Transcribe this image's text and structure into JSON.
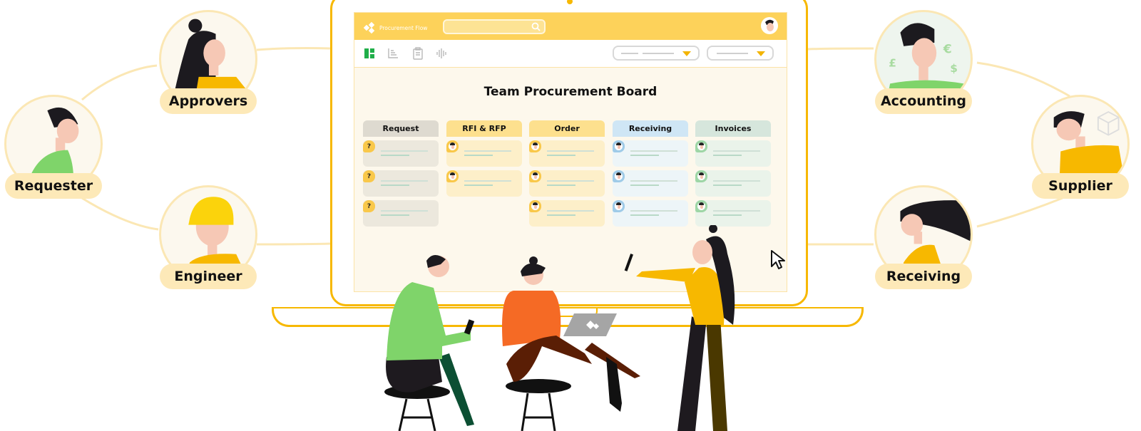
{
  "app": {
    "brand": "Procurement Flow",
    "search": {
      "placeholder": "",
      "icon": "search-icon"
    },
    "avatar": "user-avatar",
    "toolbar": {
      "icons": [
        "board-view-icon",
        "timeline-icon",
        "clipboard-icon",
        "activity-icon"
      ],
      "dropdowns": [
        {
          "value": ""
        },
        {
          "value": ""
        }
      ]
    },
    "board_title": "Team Procurement Board",
    "columns": [
      {
        "title": "Request",
        "header_color": "#dedad0",
        "card_color": "#ece8dd",
        "badge_color": "#f9c84a",
        "badge": "?",
        "cards": 3
      },
      {
        "title": "RFI & RFP",
        "header_color": "#fde08e",
        "card_color": "#fdefc9",
        "badge_color": "#f9c84a",
        "badge": "face",
        "cards": 2
      },
      {
        "title": "Order",
        "header_color": "#fde08e",
        "card_color": "#fdefc9",
        "badge_color": "#f9c84a",
        "badge": "face",
        "cards": 3
      },
      {
        "title": "Receiving",
        "header_color": "#cfe6f5",
        "card_color": "#edf5f8",
        "badge_color": "#9fcbe8",
        "badge": "face",
        "cards": 3
      },
      {
        "title": "Invoices",
        "header_color": "#d6e6dc",
        "card_color": "#eaf3ea",
        "badge_color": "#9ed6a6",
        "badge": "face",
        "cards": 3
      }
    ]
  },
  "roles": {
    "approvers": "Approvers",
    "requester": "Requester",
    "engineer": "Engineer",
    "accounting": "Accounting",
    "supplier": "Supplier",
    "receiving": "Receiving"
  },
  "colors": {
    "accent": "#f7b800",
    "topbar": "#fdd25a",
    "pill": "#fde9b8",
    "line": "#fbe7b4"
  }
}
